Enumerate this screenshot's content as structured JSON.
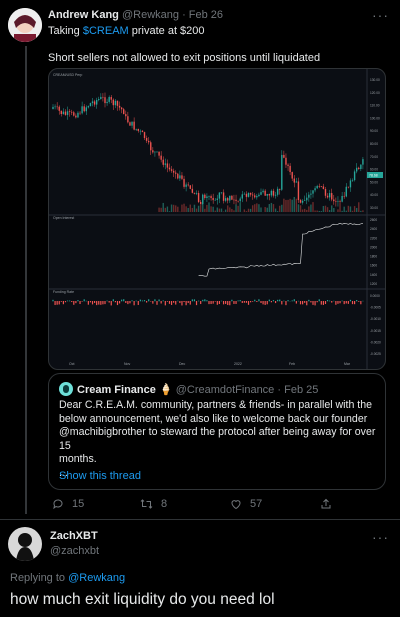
{
  "tweet": {
    "author_name": "Andrew Kang",
    "author_handle": "@Rewkang",
    "date": "Feb 26",
    "text_prefix": "Taking ",
    "cashtag": "$CREAM",
    "text_suffix": " private at $200",
    "body": "Short sellers not allowed to exit positions until liquidated"
  },
  "chart": {
    "panel1_title": "CREAM/USD Perp",
    "panel2_title": "Open Interest",
    "panel3_title": "Funding Rate",
    "price_tag": "78.68",
    "price_scale": [
      "130.00",
      "120.00",
      "110.00",
      "100.00",
      "90.00",
      "80.00",
      "70.00",
      "60.00",
      "50.00",
      "40.00",
      "30.00"
    ],
    "oi_scale": [
      "2600",
      "2400",
      "2200",
      "2000",
      "1800",
      "1600",
      "1400",
      "1200"
    ],
    "fr_scale": [
      "0.0000",
      "-0.0005",
      "-0.0010",
      "-0.0015",
      "-0.0020",
      "-0.0025"
    ],
    "x_labels": [
      "Oct",
      "Nov",
      "Dec",
      "2022",
      "Feb",
      "Mar"
    ]
  },
  "quote": {
    "name": "Cream Finance",
    "emoji": "🍦",
    "handle": "@CreamdotFinance",
    "date": "Feb 25",
    "line1": "Dear C.R.E.A.M. community, partners & friends- in parallel with the",
    "line2": "below announcement, we'd also like to welcome back our founder",
    "line3": "@machibigbrother to steward the protocol after being away for over 15",
    "line4": "months.",
    "ellipsis": "...",
    "show_thread": "Show this thread"
  },
  "actions": {
    "replies": "15",
    "retweets": "8",
    "likes": "57"
  },
  "reply": {
    "author_name": "ZachXBT",
    "author_handle": "@zachxbt",
    "replying_to_label": "Replying to ",
    "replying_to_handle": "@Rewkang",
    "text": "how much exit liquidity do you need lol"
  }
}
